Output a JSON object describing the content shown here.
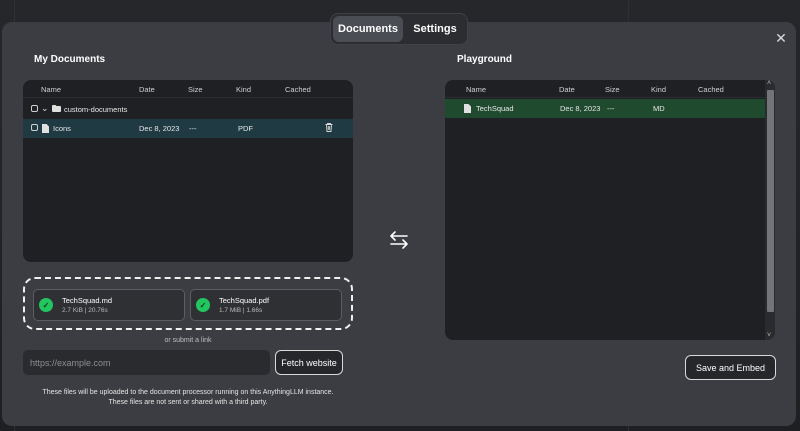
{
  "tabs": [
    {
      "label": "Documents",
      "active": true
    },
    {
      "label": "Settings",
      "active": false
    }
  ],
  "left": {
    "title": "My Documents",
    "columns": [
      "Name",
      "Date",
      "Size",
      "Kind",
      "Cached"
    ],
    "folder": {
      "name": "custom-documents"
    },
    "files": [
      {
        "name": "Icons",
        "date": "Dec 8, 2023",
        "size": "---",
        "kind": "PDF"
      }
    ]
  },
  "right": {
    "title": "Playground",
    "columns": [
      "Name",
      "Date",
      "Size",
      "Kind",
      "Cached"
    ],
    "files": [
      {
        "name": "TechSquad",
        "date": "Dec 8, 2023",
        "size": "---",
        "kind": "MD"
      }
    ]
  },
  "uploads": [
    {
      "name": "TechSquad.md",
      "meta": "2.7 KiB | 20.76s"
    },
    {
      "name": "TechSquad.pdf",
      "meta": "1.7 MiB | 1.66s"
    }
  ],
  "link": {
    "or_text": "or submit a link",
    "placeholder": "https://example.com",
    "fetch_label": "Fetch website"
  },
  "notes": [
    "These files will be uploaded to the document processor running on this AnythingLLM instance.",
    "These files are not sent or shared with a third party."
  ],
  "save_label": "Save and Embed",
  "colors": {
    "accent_green": "#22c55e",
    "selected_row": "#203a43",
    "playground_row": "#1f4a2e"
  },
  "icons": [
    "close-icon",
    "folder-icon",
    "file-icon",
    "trash-icon",
    "check-circle-icon",
    "swap-arrows-icon"
  ]
}
